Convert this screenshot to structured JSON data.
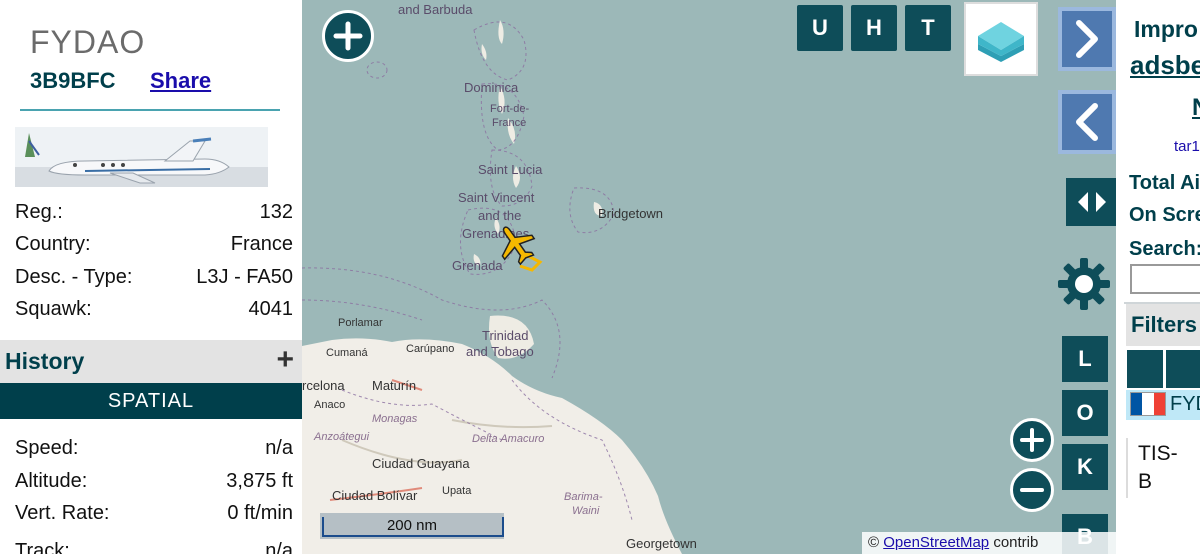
{
  "aircraft": {
    "callsign": "FYDAO",
    "hex": "3B9BFC",
    "share_label": "Share",
    "details": [
      {
        "label": "Reg.:",
        "value": "132"
      },
      {
        "label": "Country:",
        "value": "France"
      },
      {
        "label": "Desc. - Type:",
        "value": "L3J - FA50"
      },
      {
        "label": "Squawk:",
        "value": "4041"
      }
    ],
    "history_label": "History",
    "history_add": "+",
    "spatial_label": "SPATIAL",
    "flight": [
      {
        "label": "Speed:",
        "value": "n/a"
      },
      {
        "label": "Altitude:",
        "value": "3,875 ft"
      },
      {
        "label": "Vert. Rate:",
        "value": "0 ft/min"
      },
      {
        "label": "Track:",
        "value": "n/a"
      }
    ]
  },
  "map": {
    "toggles": [
      "U",
      "H",
      "T"
    ],
    "side_buttons": [
      "L",
      "O",
      "K",
      "B"
    ],
    "scale_label": "200 nm",
    "attribution_prefix": "©",
    "attribution_link": "OpenStreetMap",
    "attribution_suffix": "contrib",
    "places": [
      "and Barbuda",
      "Dominica",
      "Fort-de-",
      "France",
      "Saint Lucia",
      "Saint Vincent",
      "and the",
      "Grenadines",
      "Bridgetown",
      "Grenada",
      "Porlamar",
      "Cumaná",
      "Carúpano",
      "Trinidad",
      "and Tobago",
      "rcelona",
      "Maturín",
      "Anaco",
      "Monagas",
      "Anzoátegui",
      "Delta Amacuro",
      "Ciudad Guayana",
      "Ciudad Bolívar",
      "Upata",
      "Barima-",
      "Waini",
      "Georgetown"
    ],
    "colors": {
      "land": "#f1eee8",
      "sea": "#9cb8b8",
      "button": "#0e4d59",
      "arrow": "#4f79b0",
      "plane": "#f5b800"
    }
  },
  "sidebar": {
    "title_line1": "Impro",
    "title_line2": "adsbe",
    "title_line3": "N",
    "title_line4": "tar1",
    "total_label": "Total Ai",
    "on_screen_label": "On Scre",
    "search_label": "Search:",
    "filters_label": "Filters",
    "selected_callsign": "FYD",
    "source_label_1": "TIS-",
    "source_label_2": "B"
  }
}
